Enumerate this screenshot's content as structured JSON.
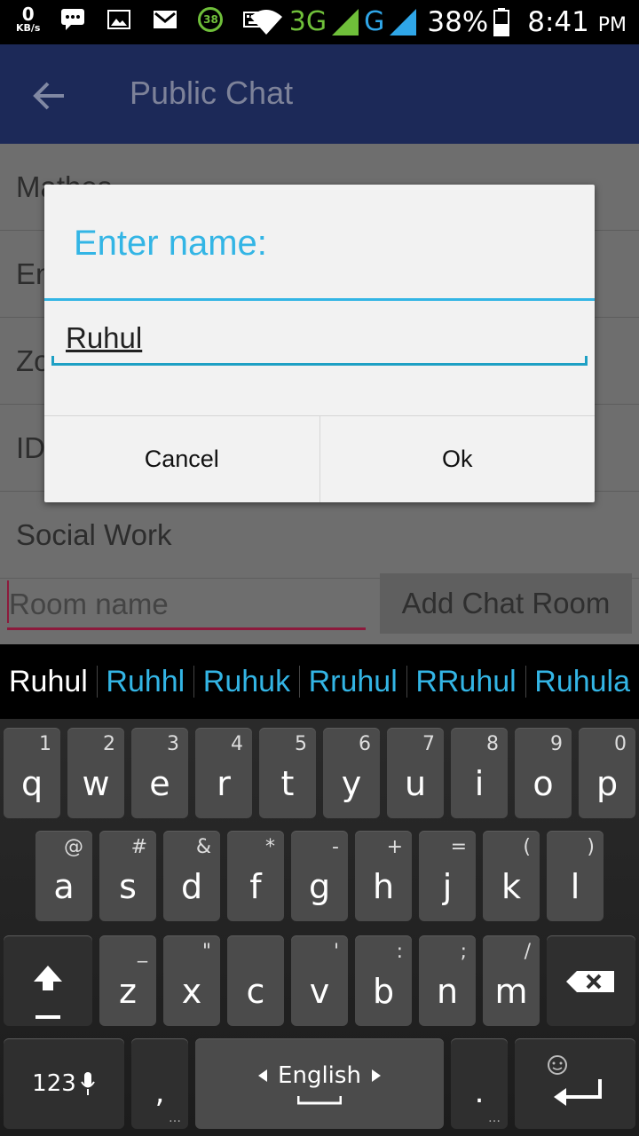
{
  "status_bar": {
    "speed_value": "0",
    "speed_unit": "KB/s",
    "badge": "38",
    "net1": "3G",
    "net2": "G",
    "battery": "38%",
    "time": "8:41",
    "ampm": "PM"
  },
  "toolbar": {
    "title": "Public Chat",
    "back_icon": "arrow-back-icon"
  },
  "list_items": [
    "Mathes",
    "En",
    "Zo",
    "ID",
    "Social Work"
  ],
  "room_input": {
    "placeholder": "Room name"
  },
  "add_button": "Add Chat Room",
  "dialog": {
    "title": "Enter name:",
    "input_value": "Ruhul",
    "cancel": "Cancel",
    "ok": "Ok"
  },
  "suggestions": [
    "Ruhul",
    "Ruhhl",
    "Ruhuk",
    "Rruhul",
    "RRuhul",
    "Ruhula"
  ],
  "keyboard": {
    "row1": [
      {
        "k": "q",
        "h": "1"
      },
      {
        "k": "w",
        "h": "2"
      },
      {
        "k": "e",
        "h": "3"
      },
      {
        "k": "r",
        "h": "4"
      },
      {
        "k": "t",
        "h": "5"
      },
      {
        "k": "y",
        "h": "6"
      },
      {
        "k": "u",
        "h": "7"
      },
      {
        "k": "i",
        "h": "8"
      },
      {
        "k": "o",
        "h": "9"
      },
      {
        "k": "p",
        "h": "0"
      }
    ],
    "row2": [
      {
        "k": "a",
        "h": "@"
      },
      {
        "k": "s",
        "h": "#"
      },
      {
        "k": "d",
        "h": "&"
      },
      {
        "k": "f",
        "h": "*"
      },
      {
        "k": "g",
        "h": "-"
      },
      {
        "k": "h",
        "h": "+"
      },
      {
        "k": "j",
        "h": "="
      },
      {
        "k": "k",
        "h": "("
      },
      {
        "k": "l",
        "h": ")"
      }
    ],
    "row3": [
      {
        "k": "z",
        "h": "_"
      },
      {
        "k": "x",
        "h": "\""
      },
      {
        "k": "c",
        "h": ""
      },
      {
        "k": "v",
        "h": "'"
      },
      {
        "k": "b",
        "h": ":"
      },
      {
        "k": "n",
        "h": ";"
      },
      {
        "k": "m",
        "h": "/"
      }
    ],
    "num_key": "123",
    "comma": ",",
    "language": "English",
    "period": "."
  }
}
